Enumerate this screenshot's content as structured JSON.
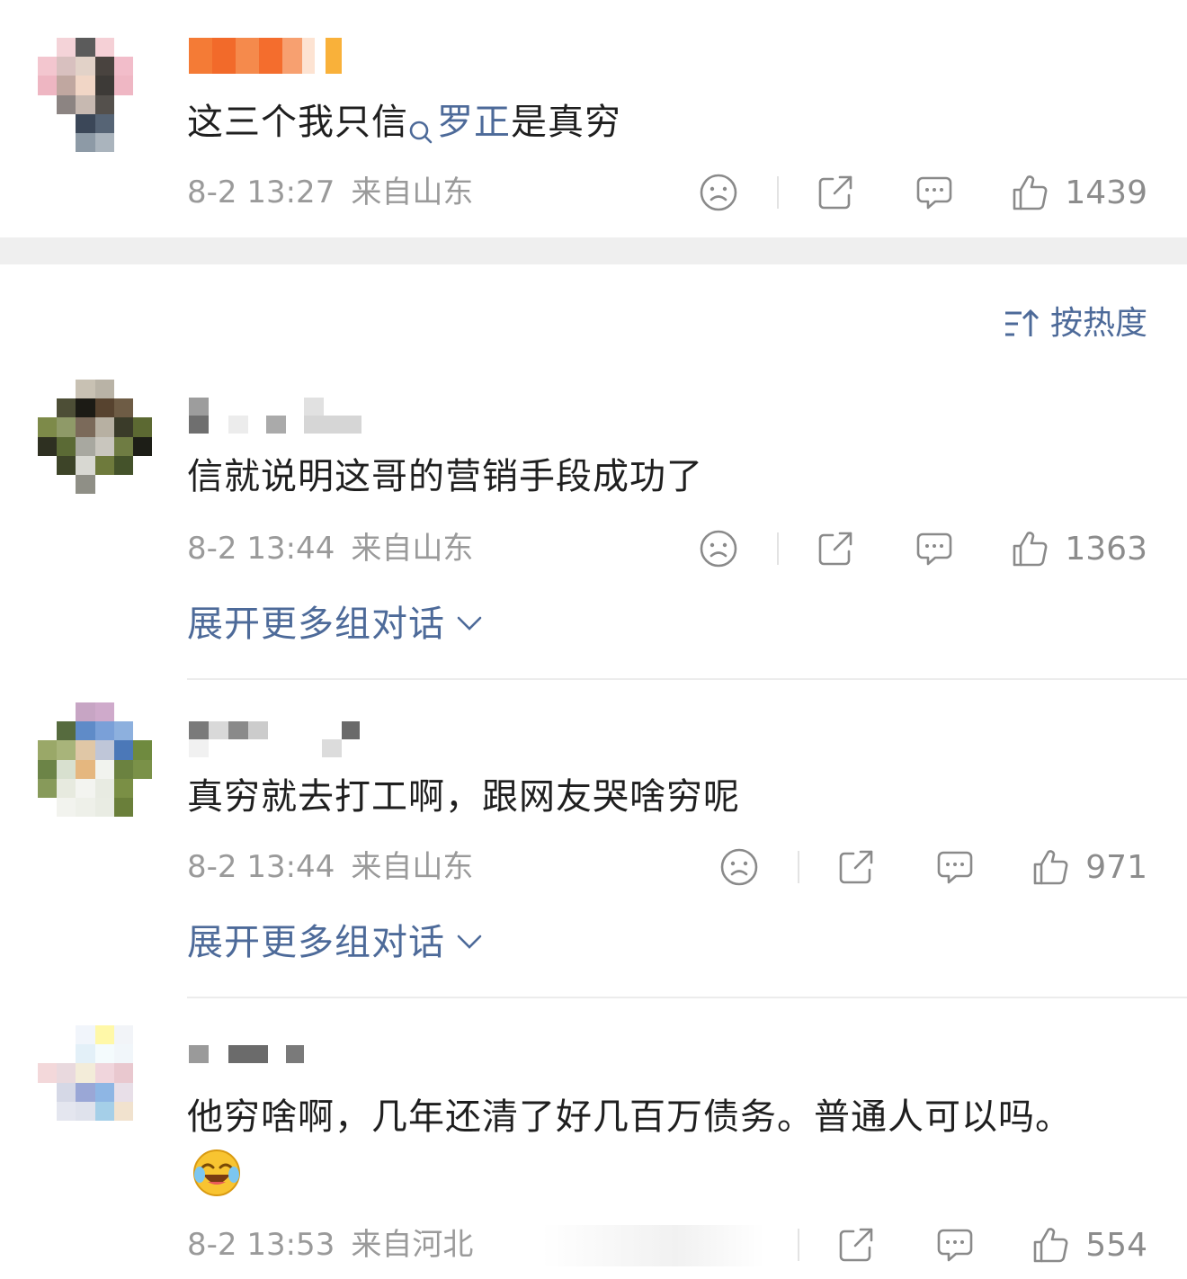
{
  "sort": {
    "label": "按热度"
  },
  "comments": [
    {
      "text_before": "这三个我只信",
      "mention": "罗正",
      "text_after": "是真穷",
      "time": "8-2 13:27",
      "source": "来自山东",
      "likes": "1439"
    },
    {
      "text": "信就说明这哥的营销手段成功了",
      "time": "8-2 13:44",
      "source": "来自山东",
      "likes": "1363",
      "expand": "展开更多组对话"
    },
    {
      "text": "真穷就去打工啊，跟网友哭啥穷呢",
      "time": "8-2 13:44",
      "source": "来自山东",
      "likes": "971",
      "expand": "展开更多组对话"
    },
    {
      "text": "他穷啥啊，几年还清了好几百万债务。普通人可以吗。",
      "emoji": "laughing-crying-emoji",
      "time": "8-2 13:53",
      "source": "来自河北",
      "likes": "554"
    }
  ],
  "colors": {
    "link": "#4d6a99",
    "meta": "#9a9a9a",
    "band": "#efefef"
  }
}
